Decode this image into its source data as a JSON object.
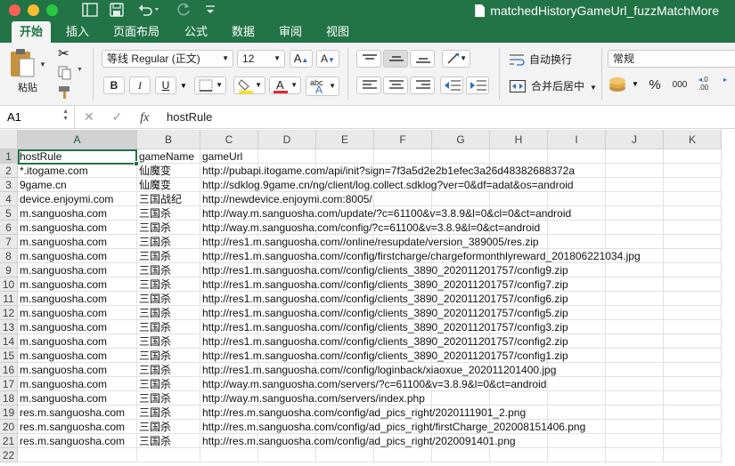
{
  "window": {
    "title": "matchedHistoryGameUrl_fuzzMatchMore"
  },
  "tabs": [
    "开始",
    "插入",
    "页面布局",
    "公式",
    "数据",
    "审阅",
    "视图"
  ],
  "ribbon": {
    "paste_label": "粘贴",
    "font_name": "等线 Regular (正文)",
    "font_size": "12",
    "grow_font": "A",
    "shrink_font": "A",
    "bold": "B",
    "italic": "I",
    "underline": "U",
    "phonetic": "abc",
    "wrap_text": "自动换行",
    "merge_center": "合并后居中",
    "number_format": "常规",
    "percent": "%",
    "comma": "000"
  },
  "formula_bar": {
    "name_box": "A1",
    "fx": "fx",
    "content": "hostRule"
  },
  "columns": [
    "A",
    "B",
    "C",
    "D",
    "E",
    "F",
    "G",
    "H",
    "I",
    "J",
    "K"
  ],
  "rows": [
    [
      "hostRule",
      "gameName",
      "gameUrl"
    ],
    [
      "*.itogame.com",
      "仙魔变",
      "http://pubapi.itogame.com/api/init?sign=7f3a5d2e2b1efec3a26d48382688372a"
    ],
    [
      "9game.cn",
      "仙魔变",
      "http://sdklog.9game.cn/ng/client/log.collect.sdklog?ver=0&df=adat&os=android"
    ],
    [
      "device.enjoymi.com",
      "三国战纪",
      "http://newdevice.enjoymi.com:8005/"
    ],
    [
      "m.sanguosha.com",
      "三国杀",
      "http://way.m.sanguosha.com/update/?c=61100&v=3.8.9&l=0&cl=0&ct=android"
    ],
    [
      "m.sanguosha.com",
      "三国杀",
      "http://way.m.sanguosha.com/config/?c=61100&v=3.8.9&l=0&ct=android"
    ],
    [
      "m.sanguosha.com",
      "三国杀",
      "http://res1.m.sanguosha.com//online/resupdate/version_389005/res.zip"
    ],
    [
      "m.sanguosha.com",
      "三国杀",
      "http://res1.m.sanguosha.com//config/firstcharge/chargeformonthlyreward_201806221034.jpg"
    ],
    [
      "m.sanguosha.com",
      "三国杀",
      "http://res1.m.sanguosha.com//config/clients_3890_202011201757/config9.zip"
    ],
    [
      "m.sanguosha.com",
      "三国杀",
      "http://res1.m.sanguosha.com//config/clients_3890_202011201757/config7.zip"
    ],
    [
      "m.sanguosha.com",
      "三国杀",
      "http://res1.m.sanguosha.com//config/clients_3890_202011201757/config6.zip"
    ],
    [
      "m.sanguosha.com",
      "三国杀",
      "http://res1.m.sanguosha.com//config/clients_3890_202011201757/config5.zip"
    ],
    [
      "m.sanguosha.com",
      "三国杀",
      "http://res1.m.sanguosha.com//config/clients_3890_202011201757/config3.zip"
    ],
    [
      "m.sanguosha.com",
      "三国杀",
      "http://res1.m.sanguosha.com//config/clients_3890_202011201757/config2.zip"
    ],
    [
      "m.sanguosha.com",
      "三国杀",
      "http://res1.m.sanguosha.com//config/clients_3890_202011201757/config1.zip"
    ],
    [
      "m.sanguosha.com",
      "三国杀",
      "http://res1.m.sanguosha.com//config/loginback/xiaoxue_202011201400.jpg"
    ],
    [
      "m.sanguosha.com",
      "三国杀",
      "http://way.m.sanguosha.com/servers/?c=61100&v=3.8.9&l=0&ct=android"
    ],
    [
      "m.sanguosha.com",
      "三国杀",
      "http://way.m.sanguosha.com/servers/index.php"
    ],
    [
      "res.m.sanguosha.com",
      "三国杀",
      "http://res.m.sanguosha.com/config/ad_pics_right/2020111901_2.png"
    ],
    [
      "res.m.sanguosha.com",
      "三国杀",
      "http://res.m.sanguosha.com/config/ad_pics_right/firstCharge_202008151406.png"
    ],
    [
      "res.m.sanguosha.com",
      "三国杀",
      "http://res.m.sanguosha.com/config/ad_pics_right/2020091401.png"
    ],
    [
      "",
      "",
      ""
    ]
  ],
  "colors": {
    "accent": "#227447",
    "selection": "#217346"
  }
}
